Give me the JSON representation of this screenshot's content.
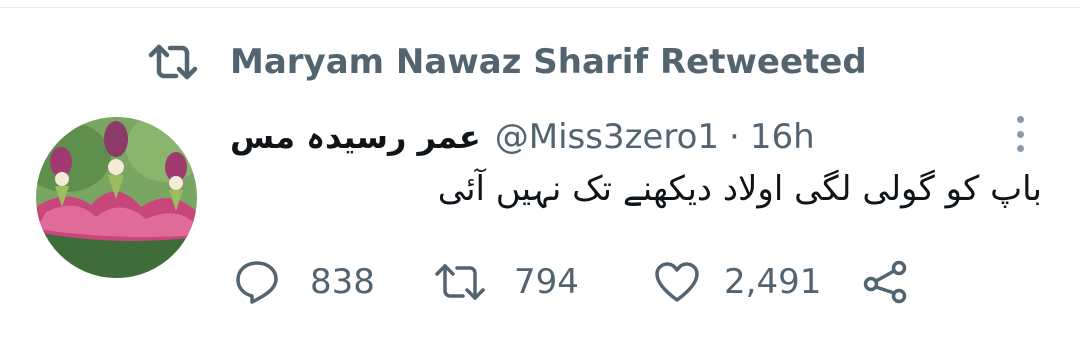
{
  "retweet_banner": {
    "text": "Maryam Nawaz Sharif Retweeted",
    "icon": "retweet-icon"
  },
  "tweet": {
    "display_name": "عمر رسیدہ مس",
    "handle": "@Miss3zero1",
    "separator": "·",
    "time": "16h",
    "text": "باپ کو گولی لگی اولاد دیکھنے تک نہیں آئی",
    "avatar": "avatar-flower-fairies"
  },
  "actions": {
    "reply_count": "838",
    "retweet_count": "794",
    "like_count": "2,491",
    "icons": [
      "reply-icon",
      "retweet-icon",
      "like-icon",
      "share-icon"
    ]
  },
  "colors": {
    "secondary_text": "#536471",
    "primary_text": "#0f1419",
    "background": "#ffffff"
  }
}
